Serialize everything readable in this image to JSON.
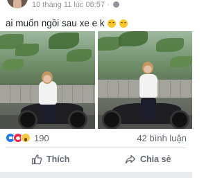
{
  "post": {
    "timestamp": "10 tháng 11 lúc 06:57",
    "separator": "·",
    "caption": "ai muốn ngồi sau xe e k"
  },
  "icons": {
    "avatar": "profile-avatar",
    "privacy": "globe-icon",
    "emoji": "grinning-sweat-emoji",
    "reactions": [
      "like-icon",
      "love-icon",
      "wow-icon"
    ],
    "like_action": "thumbs-up-icon",
    "share_action": "share-arrow-icon"
  },
  "stats": {
    "reaction_count": "190",
    "comment_count": "42 bình luận"
  },
  "actions": {
    "like_label": "Thích",
    "share_label": "Chia sẻ"
  },
  "colors": {
    "like_blue": "#2078f4",
    "love_red": "#f0284a",
    "wow_yellow": "#f7c843",
    "muted_text": "#606770"
  }
}
